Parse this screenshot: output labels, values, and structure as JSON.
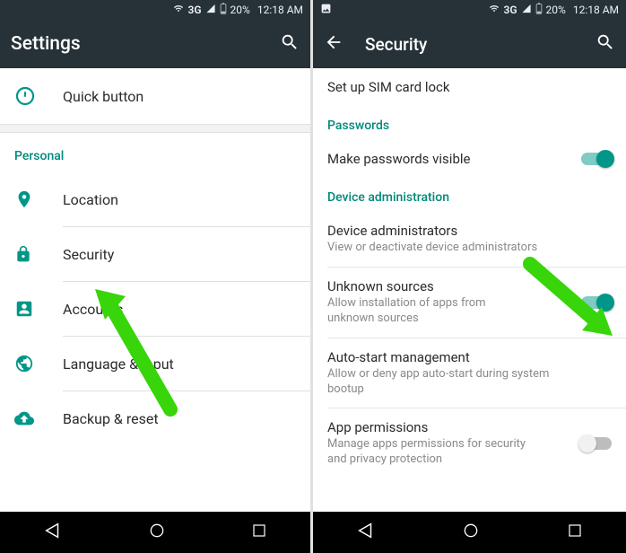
{
  "status": {
    "network": "3G",
    "signal_icon": "signal-icon",
    "battery_pct": "20%",
    "time": "12:18 AM",
    "picture_icon": "picture-icon"
  },
  "screen_left": {
    "title": "Settings",
    "quick_button": "Quick button",
    "personal": {
      "header": "Personal",
      "items": [
        {
          "icon": "location-icon",
          "label": "Location"
        },
        {
          "icon": "lock-icon",
          "label": "Security"
        },
        {
          "icon": "accounts-icon",
          "label": "Accounts"
        },
        {
          "icon": "language-icon",
          "label": "Language & input"
        },
        {
          "icon": "backup-icon",
          "label": "Backup & reset"
        }
      ]
    }
  },
  "screen_right": {
    "title": "Security",
    "truncated_header": "SIM card lock",
    "sim_lock": "Set up SIM card lock",
    "passwords": {
      "header": "Passwords",
      "item": "Make passwords visible",
      "toggle": true
    },
    "device_admin": {
      "header": "Device administration",
      "items": [
        {
          "title": "Device administrators",
          "subtitle": "View or deactivate device administrators"
        },
        {
          "title": "Unknown sources",
          "subtitle": "Allow installation of apps from unknown sources",
          "toggle": true
        },
        {
          "title": "Auto-start management",
          "subtitle": "Allow or deny app auto-start during system bootup"
        },
        {
          "title": "App permissions",
          "subtitle": "Manage apps permissions for security and privacy protection",
          "toggle": false
        }
      ]
    }
  },
  "annotations": {
    "arrow_color": "#37d50a"
  }
}
